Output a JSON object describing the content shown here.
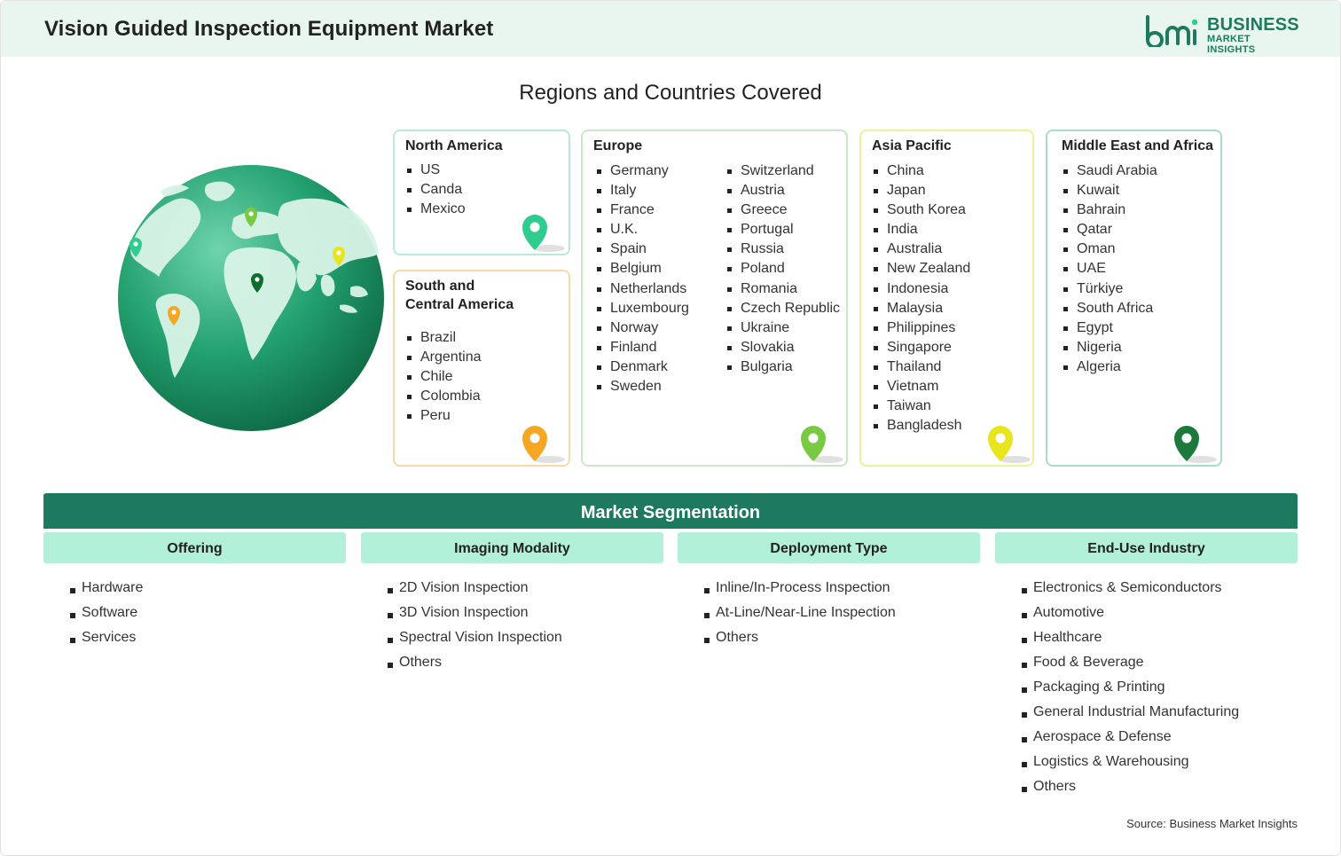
{
  "header": {
    "title": "Vision Guided Inspection Equipment Market",
    "logo": {
      "line1": "BUSINESS",
      "line2": "MARKET INSIGHTS",
      "color": "#1d7a5e"
    }
  },
  "regions_heading": "Regions and Countries Covered",
  "regions": {
    "north_america": {
      "title": "North America",
      "countries": [
        "US",
        "Canda",
        "Mexico"
      ],
      "pin_color": "#2ecc8f"
    },
    "south_central_america": {
      "title_line1": "South and",
      "title_line2": "Central America",
      "countries": [
        "Brazil",
        "Argentina",
        "Chile",
        "Colombia",
        "Peru"
      ],
      "pin_color": "#f5a623"
    },
    "europe": {
      "title": "Europe",
      "countries_col1": [
        "Germany",
        "Italy",
        "France",
        "U.K.",
        "Spain",
        "Belgium",
        "Netherlands",
        "Luxembourg",
        "Norway",
        "Finland",
        "Denmark",
        "Sweden"
      ],
      "countries_col2": [
        "Switzerland",
        "Austria",
        "Greece",
        "Portugal",
        "Russia",
        "Poland",
        "Romania",
        "Czech Republic",
        "Ukraine",
        "Slovakia",
        "Bulgaria"
      ],
      "pin_color": "#7ac943"
    },
    "asia_pacific": {
      "title": "Asia Pacific",
      "countries": [
        "China",
        "Japan",
        "South Korea",
        "India",
        "Australia",
        "New Zealand",
        "Indonesia",
        "Malaysia",
        "Philippines",
        "Singapore",
        "Thailand",
        "Vietnam",
        "Taiwan",
        "Bangladesh"
      ],
      "pin_color": "#e8e51f"
    },
    "middle_east_africa": {
      "title": "Middle East and Africa",
      "countries": [
        "Saudi Arabia",
        "Kuwait",
        "Bahrain",
        "Qatar",
        "Oman",
        "UAE",
        "Türkiye",
        "South Africa",
        "Egypt",
        "Nigeria",
        "Algeria"
      ],
      "pin_color": "#1d7a3e"
    }
  },
  "segmentation": {
    "title": "Market Segmentation",
    "columns": [
      {
        "heading": "Offering",
        "items": [
          "Hardware",
          "Software",
          "Services"
        ]
      },
      {
        "heading": "Imaging Modality",
        "items": [
          "2D Vision Inspection",
          "3D Vision Inspection",
          "Spectral Vision Inspection",
          "Others"
        ]
      },
      {
        "heading": "Deployment Type",
        "items": [
          "Inline/In-Process Inspection",
          "At-Line/Near-Line Inspection",
          "Others"
        ]
      },
      {
        "heading": "End-Use Industry",
        "items": [
          "Electronics & Semiconductors",
          "Automotive",
          "Healthcare",
          "Food & Beverage",
          "Packaging & Printing",
          "General Industrial Manufacturing",
          "Aerospace & Defense",
          "Logistics & Warehousing",
          "Others"
        ]
      }
    ]
  },
  "source": "Source: Business Market Insights",
  "colors": {
    "brand_green": "#1d7a5e",
    "segment_head_bg": "#b3f0d9",
    "header_bg": "#e9f6ef"
  }
}
